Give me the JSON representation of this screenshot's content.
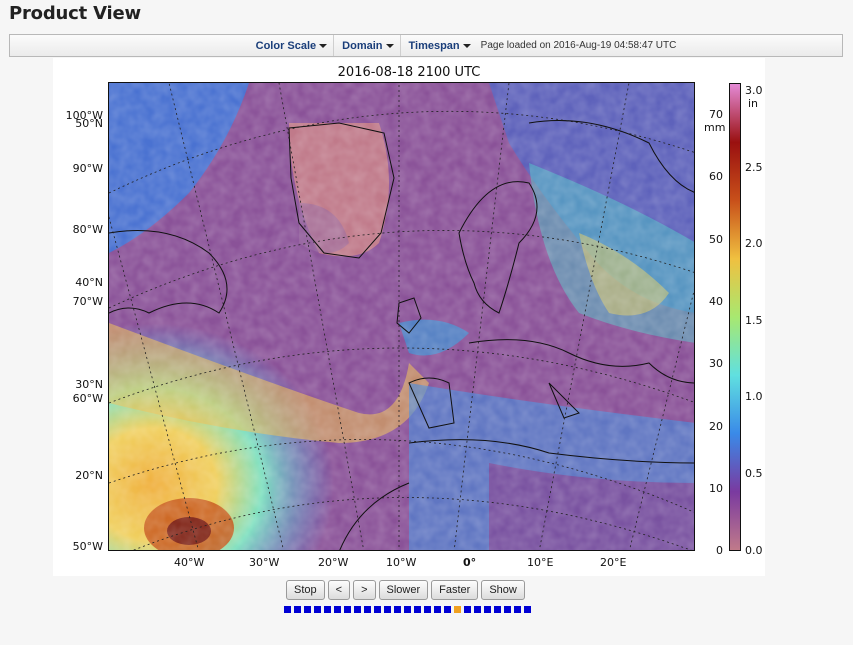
{
  "page": {
    "title": "Product View"
  },
  "toolbar": {
    "menus": [
      {
        "label": "Color Scale"
      },
      {
        "label": "Domain"
      },
      {
        "label": "Timespan"
      }
    ],
    "status": "Page loaded on 2016-Aug-19 04:58:47 UTC"
  },
  "map": {
    "title": "2016-08-18 2100 UTC",
    "lon_labels": [
      "40°W",
      "30°W",
      "20°W",
      "10°W",
      "0°",
      "10°E",
      "20°E"
    ],
    "lat_labels_left": [
      "100°W",
      "50°N",
      "90°W",
      "80°W",
      "40°N",
      "70°W",
      "30°N",
      "60°W",
      "20°N",
      "50°W"
    ]
  },
  "colorbar": {
    "mm_ticks": [
      "70",
      "60",
      "50",
      "40",
      "30",
      "20",
      "10",
      "0"
    ],
    "mm_unit": "mm",
    "in_ticks": [
      "3.0",
      "2.5",
      "2.0",
      "1.5",
      "1.0",
      "0.5",
      "0.0"
    ],
    "in_unit": "in",
    "colors": [
      "#e48ad6",
      "#9a1010",
      "#c8501a",
      "#f0c040",
      "#a8e870",
      "#60e0e0",
      "#3a8ae8",
      "#7a3aa0",
      "#c07a8a"
    ]
  },
  "controls": {
    "buttons": [
      "Stop",
      "<",
      ">",
      "Slower",
      "Faster",
      "Show"
    ]
  },
  "frames": {
    "count": 25,
    "current_index": 17
  }
}
